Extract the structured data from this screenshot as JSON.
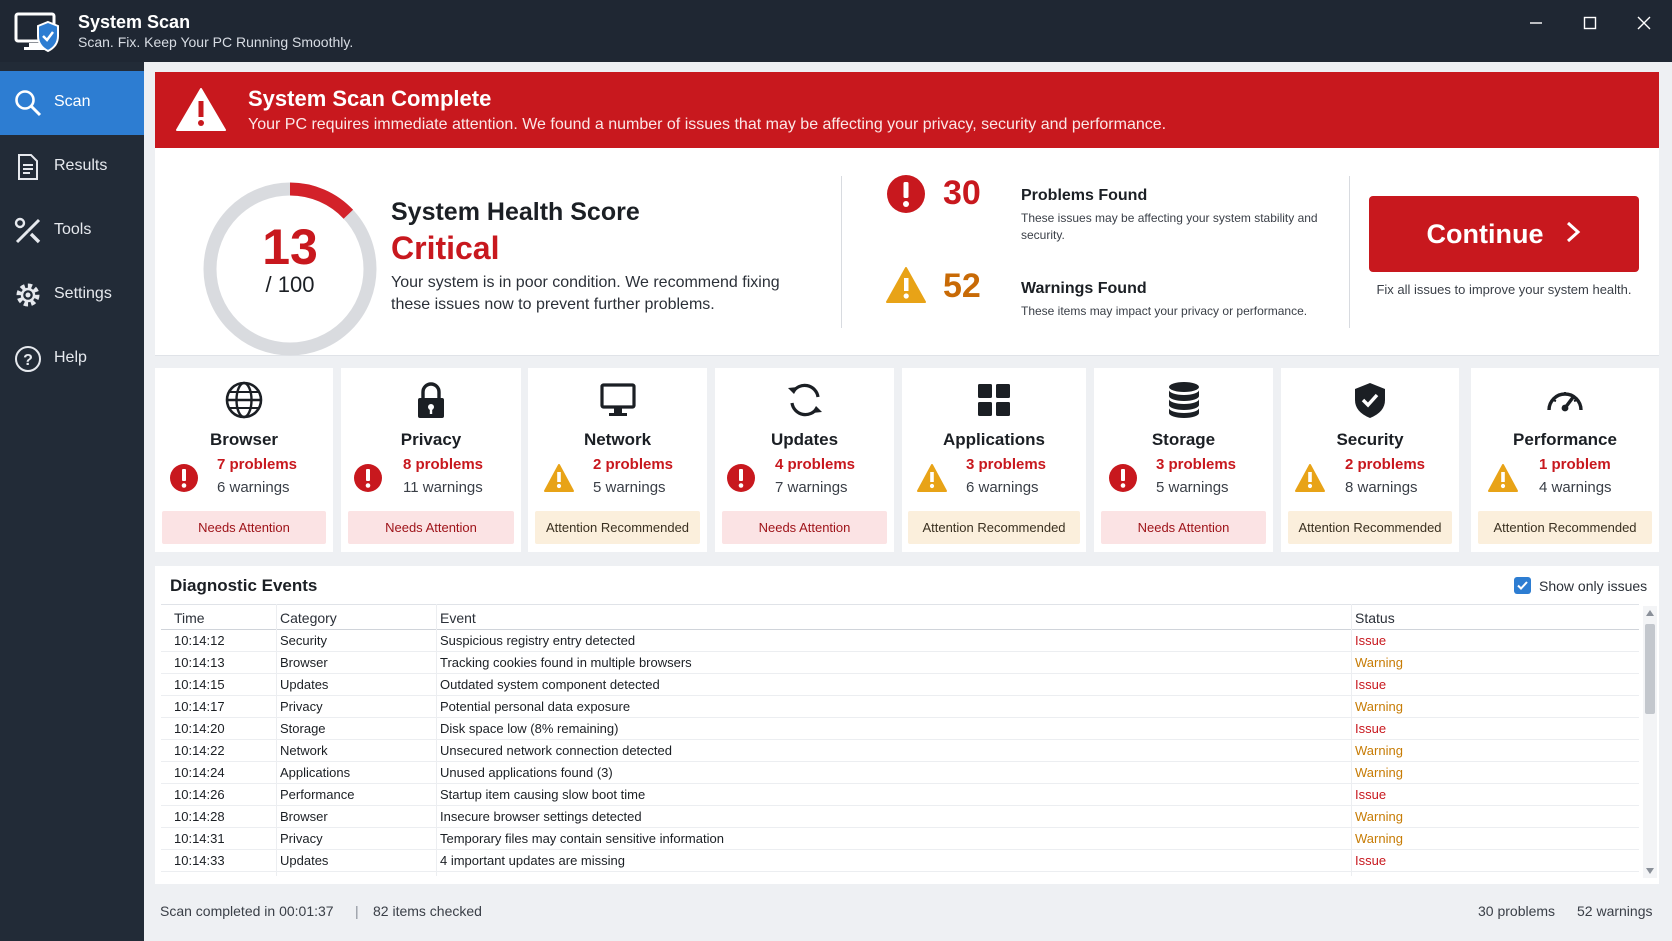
{
  "app": {
    "title": "System Scan",
    "subtitle": "Scan. Fix. Keep Your PC Running Smoothly."
  },
  "window_controls": [
    "minimize-icon",
    "maximize-icon",
    "close-icon"
  ],
  "sidebar": {
    "items": [
      {
        "label": "Scan",
        "icon": "search-icon",
        "active": true
      },
      {
        "label": "Results",
        "icon": "document-icon",
        "active": false
      },
      {
        "label": "Tools",
        "icon": "tools-icon",
        "active": false
      },
      {
        "label": "Settings",
        "icon": "gear-icon",
        "active": false
      },
      {
        "label": "Help",
        "icon": "help-icon",
        "active": false
      }
    ]
  },
  "banner": {
    "title": "System Scan Complete",
    "text": "Your PC requires immediate attention. We found a number of issues that may be affecting your privacy, security and performance."
  },
  "health": {
    "score": "13",
    "max": "/ 100",
    "score_fraction": 0.13,
    "title": "System Health Score",
    "status": "Critical",
    "description": "Your system is in poor condition. We recommend fixing these issues now to prevent further problems."
  },
  "problems": {
    "count": "30",
    "label": "Problems Found",
    "description": "These issues may be affecting your system stability and security."
  },
  "warnings": {
    "count": "52",
    "label": "Warnings Found",
    "description": "These items may impact your privacy or performance."
  },
  "continue": {
    "label": "Continue",
    "hint": "Fix all issues to improve your system health."
  },
  "categories": [
    {
      "name": "Browser",
      "icon": "globe-icon",
      "severity": "error",
      "problems": "7 problems",
      "warnings": "6 warnings",
      "badge": "Needs Attention"
    },
    {
      "name": "Privacy",
      "icon": "lock-icon",
      "severity": "error",
      "problems": "8 problems",
      "warnings": "11 warnings",
      "badge": "Needs Attention"
    },
    {
      "name": "Network",
      "icon": "monitor-icon",
      "severity": "warning",
      "problems": "2 problems",
      "warnings": "5 warnings",
      "badge": "Attention Recommended"
    },
    {
      "name": "Updates",
      "icon": "refresh-icon",
      "severity": "error",
      "problems": "4 problems",
      "warnings": "7 warnings",
      "badge": "Needs Attention"
    },
    {
      "name": "Applications",
      "icon": "apps-grid-icon",
      "severity": "warning",
      "problems": "3 problems",
      "warnings": "6 warnings",
      "badge": "Attention Recommended"
    },
    {
      "name": "Storage",
      "icon": "database-icon",
      "severity": "error",
      "problems": "3 problems",
      "warnings": "5 warnings",
      "badge": "Needs Attention"
    },
    {
      "name": "Security",
      "icon": "shield-check-icon",
      "severity": "warning",
      "problems": "2 problems",
      "warnings": "8 warnings",
      "badge": "Attention Recommended"
    },
    {
      "name": "Performance",
      "icon": "speedometer-icon",
      "severity": "warning",
      "problems": "1 problem",
      "warnings": "4 warnings",
      "badge": "Attention Recommended"
    }
  ],
  "events": {
    "title": "Diagnostic Events",
    "show_only_issues_label": "Show only issues",
    "show_only_issues_checked": true,
    "columns": [
      "Time",
      "Category",
      "Event",
      "Status"
    ],
    "rows": [
      {
        "time": "10:14:12",
        "category": "Security",
        "event": "Suspicious registry entry detected",
        "status": "Issue"
      },
      {
        "time": "10:14:13",
        "category": "Browser",
        "event": "Tracking cookies found in multiple browsers",
        "status": "Warning"
      },
      {
        "time": "10:14:15",
        "category": "Updates",
        "event": "Outdated system component detected",
        "status": "Issue"
      },
      {
        "time": "10:14:17",
        "category": "Privacy",
        "event": "Potential personal data exposure",
        "status": "Warning"
      },
      {
        "time": "10:14:20",
        "category": "Storage",
        "event": "Disk space low (8% remaining)",
        "status": "Issue"
      },
      {
        "time": "10:14:22",
        "category": "Network",
        "event": "Unsecured network connection detected",
        "status": "Warning"
      },
      {
        "time": "10:14:24",
        "category": "Applications",
        "event": "Unused applications found (3)",
        "status": "Warning"
      },
      {
        "time": "10:14:26",
        "category": "Performance",
        "event": "Startup item causing slow boot time",
        "status": "Issue"
      },
      {
        "time": "10:14:28",
        "category": "Browser",
        "event": "Insecure browser settings detected",
        "status": "Warning"
      },
      {
        "time": "10:14:31",
        "category": "Privacy",
        "event": "Temporary files may contain sensitive information",
        "status": "Warning"
      },
      {
        "time": "10:14:33",
        "category": "Updates",
        "event": "4 important updates are missing",
        "status": "Issue"
      }
    ]
  },
  "footer": {
    "scan_time": "Scan completed in 00:01:37",
    "separator": "|",
    "items_checked": "82 items checked",
    "problems": "30 problems",
    "warnings": "52 warnings"
  },
  "colors": {
    "accent": "#2d7dd2",
    "danger": "#c8181e",
    "warning": "#e8a317",
    "sidebar": "#222b37",
    "titlebar": "#1f2733"
  }
}
